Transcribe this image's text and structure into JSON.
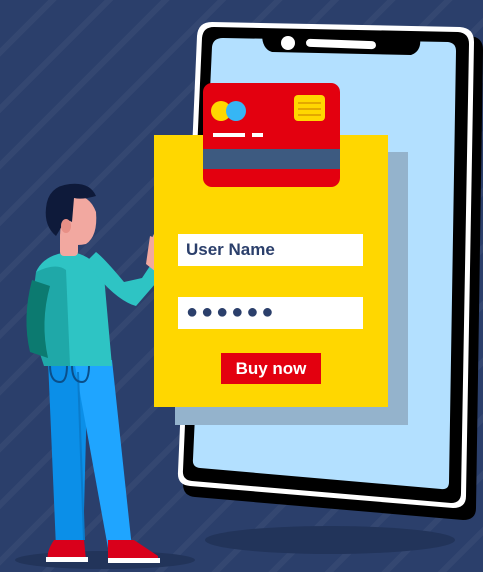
{
  "form": {
    "username_label": "User Name",
    "password_mask": "●●●●●●",
    "buy_label": "Buy now"
  },
  "colors": {
    "background": "#2b3f6b",
    "phone_body": "#000000",
    "phone_screen": "#b3e0ff",
    "form_panel": "#ffd700",
    "card": "#e3000f",
    "button": "#e3000f",
    "text": "#2b3f6b"
  },
  "icons": [
    "credit-card-icon",
    "card-chip-icon",
    "card-logo-icon"
  ]
}
